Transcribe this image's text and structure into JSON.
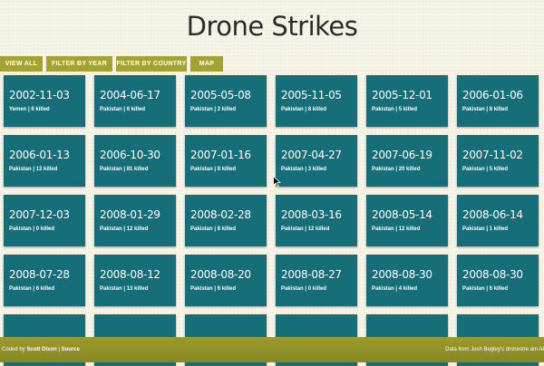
{
  "title": "Drone Strikes",
  "tabs": [
    "VIEW ALL",
    "FILTER BY YEAR",
    "FILTER BY COUNTRY",
    "MAP"
  ],
  "strikes": [
    {
      "date": "2002-11-03",
      "info": "Yemen | 6 killed"
    },
    {
      "date": "2004-06-17",
      "info": "Pakistan | 6 killed"
    },
    {
      "date": "2005-05-08",
      "info": "Pakistan | 2 killed"
    },
    {
      "date": "2005-11-05",
      "info": "Pakistan | 8 killed"
    },
    {
      "date": "2005-12-01",
      "info": "Pakistan | 5 killed"
    },
    {
      "date": "2006-01-06",
      "info": "Pakistan | 8 killed"
    },
    {
      "date": "2006-01-13",
      "info": "Pakistan | 13 killed"
    },
    {
      "date": "2006-10-30",
      "info": "Pakistan | 81 killed"
    },
    {
      "date": "2007-01-16",
      "info": "Pakistan | 8 killed"
    },
    {
      "date": "2007-04-27",
      "info": "Pakistan | 3 killed"
    },
    {
      "date": "2007-06-19",
      "info": "Pakistan | 20 killed"
    },
    {
      "date": "2007-11-02",
      "info": "Pakistan | 5 killed"
    },
    {
      "date": "2007-12-03",
      "info": "Pakistan | 0 killed"
    },
    {
      "date": "2008-01-29",
      "info": "Pakistan | 12 killed"
    },
    {
      "date": "2008-02-28",
      "info": "Pakistan | 8 killed"
    },
    {
      "date": "2008-03-16",
      "info": "Pakistan | 12 killed"
    },
    {
      "date": "2008-05-14",
      "info": "Pakistan | 12 killed"
    },
    {
      "date": "2008-06-14",
      "info": "Pakistan | 1 killed"
    },
    {
      "date": "2008-07-28",
      "info": "Pakistan | 6 killed"
    },
    {
      "date": "2008-08-12",
      "info": "Pakistan | 13 killed"
    },
    {
      "date": "2008-08-20",
      "info": "Pakistan | 6 killed"
    },
    {
      "date": "2008-08-27",
      "info": "Pakistan | 0 killed"
    },
    {
      "date": "2008-08-30",
      "info": "Pakistan | 4 killed"
    },
    {
      "date": "2008-08-30",
      "info": "Pakistan | 6 killed"
    },
    {
      "date": "",
      "info": ""
    },
    {
      "date": "",
      "info": ""
    },
    {
      "date": "",
      "info": ""
    },
    {
      "date": "",
      "info": ""
    },
    {
      "date": "",
      "info": ""
    },
    {
      "date": "",
      "info": ""
    }
  ],
  "footer": {
    "left_prefix": "Coded by ",
    "author": "Scott Dixon",
    "sep": " | ",
    "source": "Source",
    "right": "Data from Josh Begley's dronestre.am API"
  },
  "colors": {
    "card": "#156e78",
    "accent": "#a3a233",
    "footer": "#8f8f29",
    "background": "#f6f4e6"
  },
  "icons": {
    "cursor": "arrow-cursor-icon"
  }
}
